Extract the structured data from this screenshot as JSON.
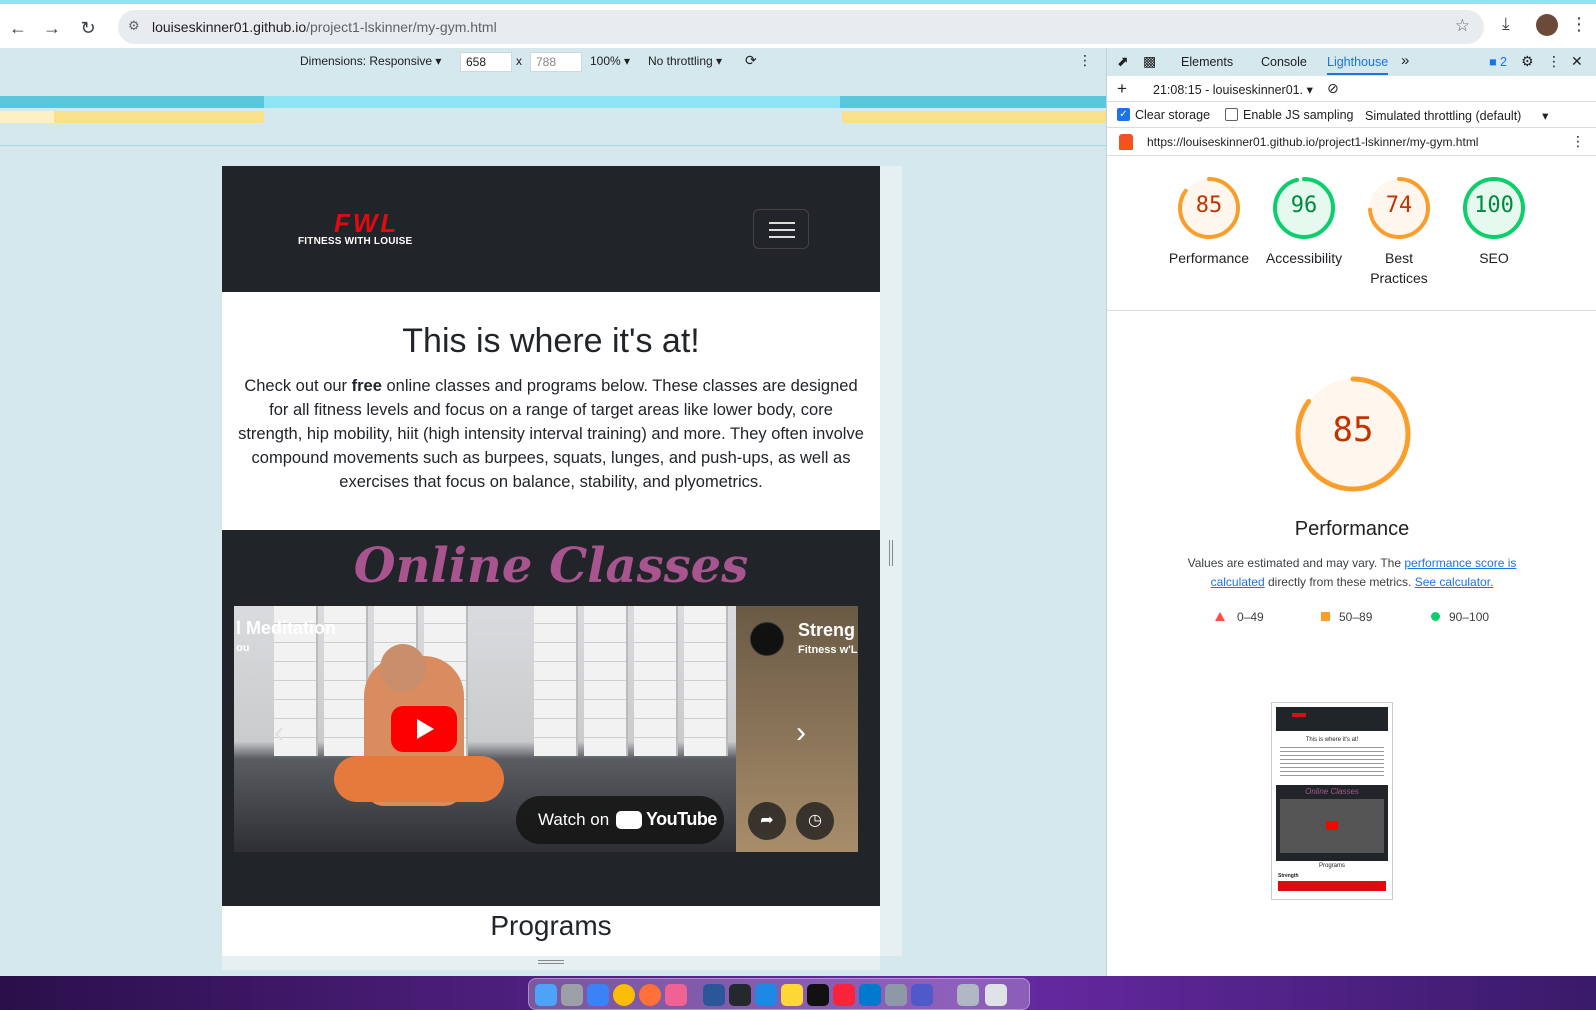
{
  "browser": {
    "url_host": "louiseskinner01.github.io",
    "url_path": "/project1-lskinner/my-gym.html"
  },
  "device_toolbar": {
    "dimensions_label": "Dimensions: Responsive",
    "width": "658",
    "height": "788",
    "zoom": "100%",
    "throttling": "No throttling"
  },
  "site": {
    "logo_main": "FWL",
    "logo_sub": "FITNESS WITH LOUISE",
    "hero_title": "This is where it's at!",
    "hero_text_before": "Check out our ",
    "hero_text_bold": "free",
    "hero_text_after": " online classes and programs below. These classes are designed for all fitness levels and focus on a range of target areas like lower body, core strength, hip mobility, hiit (high intensity interval training) and more. They often involve compound movements such as burpees, squats, lunges, and push-ups, as well as exercises that focus on balance, stability, and plyometrics.",
    "classes_title": "Online Classes",
    "video_main_title": "l Meditation",
    "video_main_channel": "ou",
    "watch_on": "Watch on",
    "youtube": "YouTube",
    "video_side_title": "Streng",
    "video_side_channel": "Fitness w'L",
    "programs_title": "Programs"
  },
  "devtools": {
    "tabs": [
      "Elements",
      "Console",
      "Lighthouse"
    ],
    "active_tab": "Lighthouse",
    "issues_count": "2",
    "report_select": "21:08:15 - louiseskinner01.",
    "clear_storage": "Clear storage",
    "enable_js_sampling": "Enable JS sampling",
    "throttling": "Simulated throttling (default)",
    "report_url": "https://louiseskinner01.github.io/project1-lskinner/my-gym.html",
    "scores": [
      {
        "label": "Performance",
        "value": "85",
        "score": 85,
        "color": "#fa9e2b"
      },
      {
        "label": "Accessibility",
        "value": "96",
        "score": 96,
        "color": "#0cce6b"
      },
      {
        "label": "Best Practices",
        "value": "74",
        "score": 74,
        "color": "#fa9e2b"
      },
      {
        "label": "SEO",
        "value": "100",
        "score": 100,
        "color": "#0cce6b"
      }
    ],
    "big_score": "85",
    "big_label": "Performance",
    "note_before": "Values are estimated and may vary. The ",
    "note_link1": "performance score is calculated",
    "note_middle": " directly from these metrics. ",
    "note_link2": "See calculator.",
    "legend": [
      {
        "range": "0–49",
        "color": "#ff4e42"
      },
      {
        "range": "50–89",
        "color": "#fa9e2b"
      },
      {
        "range": "90–100",
        "color": "#0cce6b"
      }
    ],
    "thumb_title": "This is where it's at!",
    "thumb_classes": "Online Classes",
    "thumb_programs": "Programs",
    "thumb_strength": "Strength"
  }
}
